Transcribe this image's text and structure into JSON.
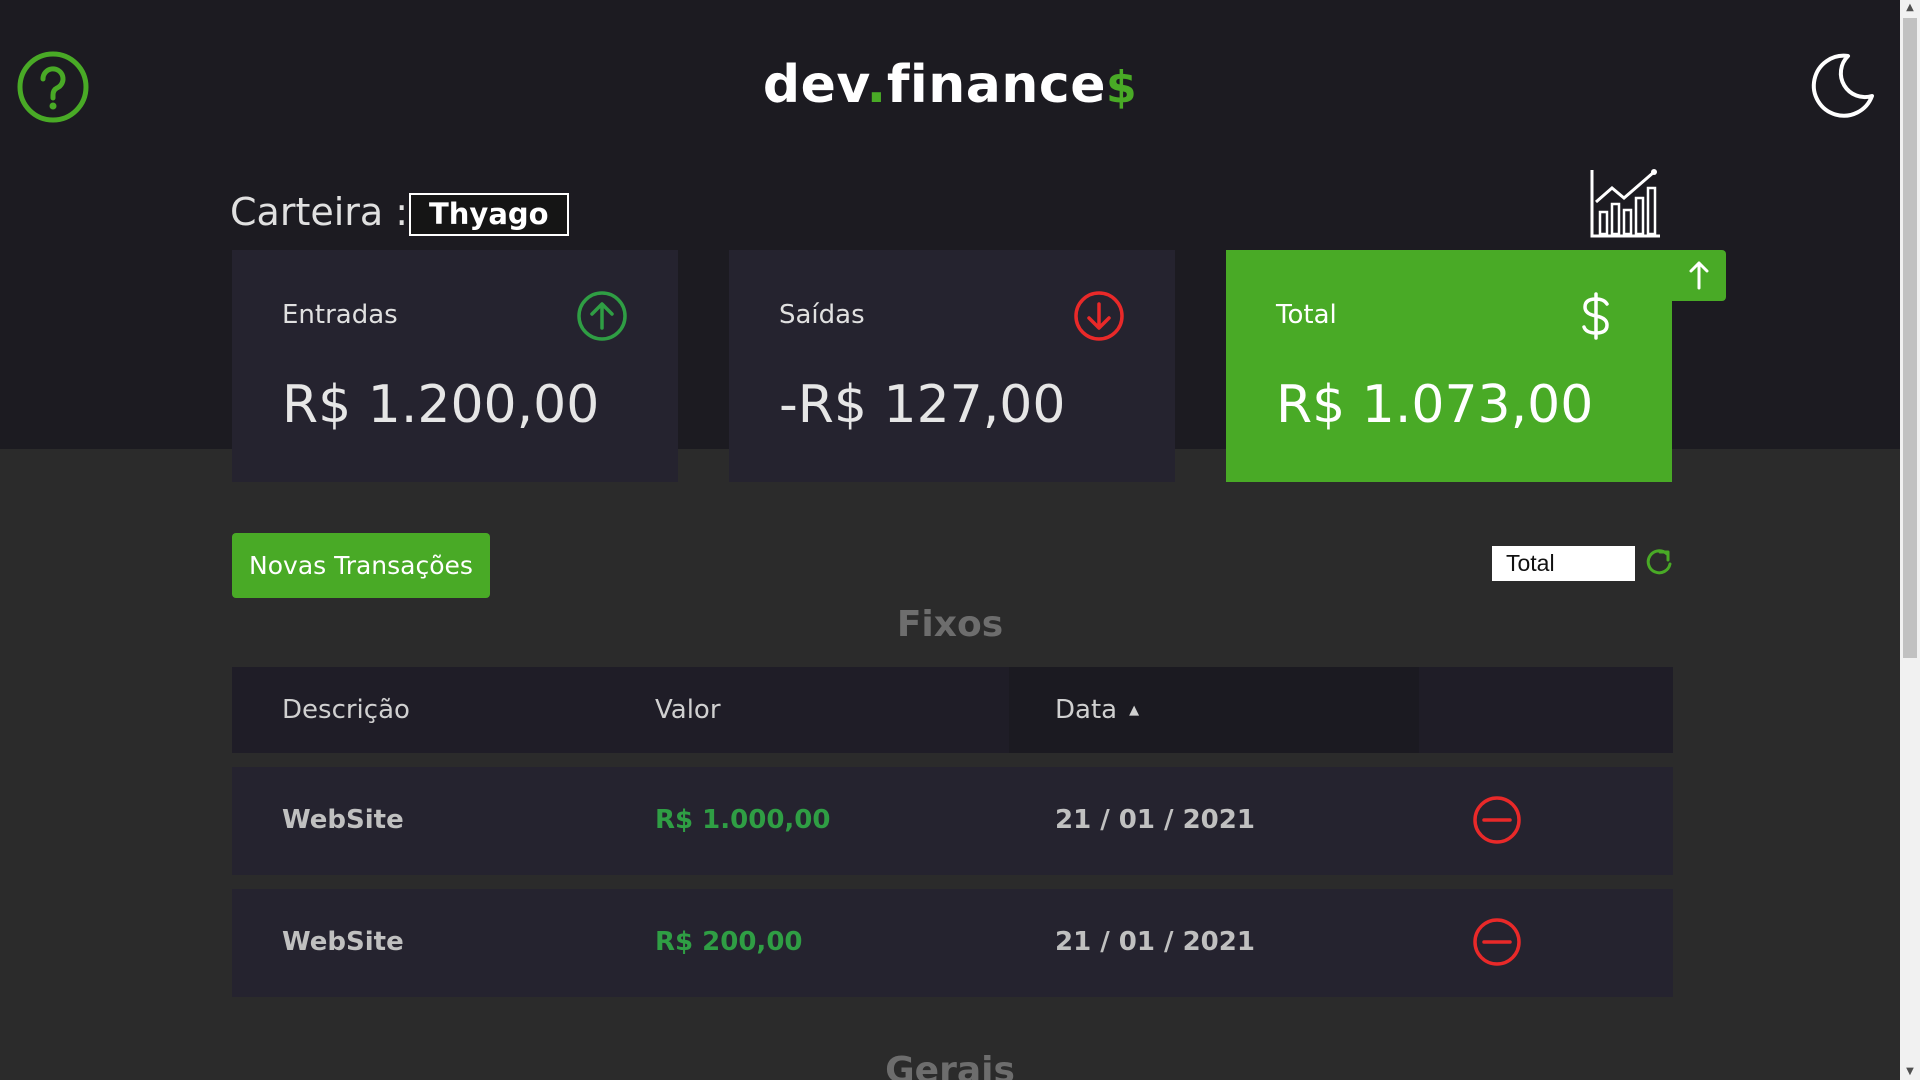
{
  "header": {
    "logo_main": "dev",
    "logo_dot": ".",
    "logo_rest": "finance",
    "logo_symbol": "$",
    "help_icon": "question-circle-icon",
    "theme_icon": "moon-icon"
  },
  "wallet": {
    "label": "Carteira :",
    "name": "Thyago",
    "chart_icon": "line-chart-icon"
  },
  "cards": {
    "income": {
      "title": "Entradas",
      "value": "R$ 1.200,00",
      "icon": "arrow-up-circle-icon"
    },
    "expense": {
      "title": "Saídas",
      "value": "-R$ 127,00",
      "icon": "arrow-down-circle-icon"
    },
    "total": {
      "title": "Total",
      "value": "R$ 1.073,00",
      "icon": "dollar-icon"
    }
  },
  "actions": {
    "new_transaction": "Novas Transações",
    "filter_value": "Total",
    "refresh_icon": "refresh-icon"
  },
  "fixed": {
    "title": "Fixos",
    "columns": [
      "Descrição",
      "Valor",
      "Data"
    ],
    "sort_indicator": "▲",
    "rows": [
      {
        "description": "WebSite",
        "value": "R$ 1.000,00",
        "date": "21 / 01 / 2021"
      },
      {
        "description": "WebSite",
        "value": "R$ 200,00",
        "date": "21 / 01 / 2021"
      }
    ]
  },
  "general": {
    "title": "Gerais"
  },
  "colors": {
    "accent": "#49aa26",
    "danger": "#e92929",
    "card": "#25232f",
    "header": "#1c1b21"
  }
}
